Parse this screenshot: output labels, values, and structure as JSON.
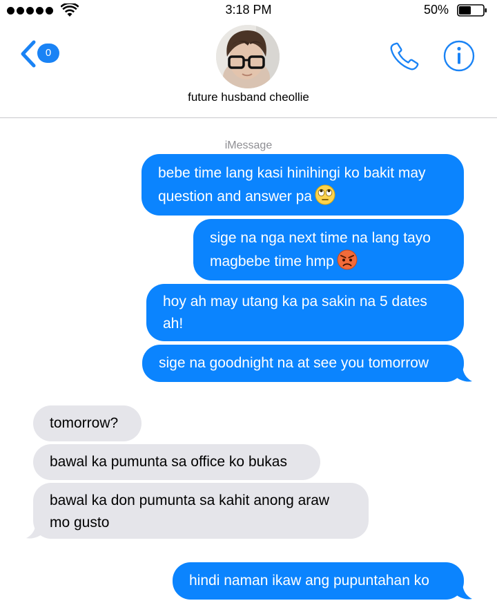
{
  "status_bar": {
    "time": "3:18 PM",
    "battery": "50%",
    "battery_level": 0.5
  },
  "header": {
    "back_badge_count": "0",
    "contact_name": "future husband cheollie"
  },
  "conversation": {
    "service_label": "iMessage",
    "messages": [
      {
        "direction": "sent",
        "lines": [
          "bebe time lang kasi hinihingi ko bakit may",
          "question and answer pa"
        ],
        "emoji": "face-with-rolling-eyes"
      },
      {
        "direction": "sent",
        "lines": [
          "sige na nga next time na lang tayo",
          "magbebe time hmp"
        ],
        "emoji": "angry-face"
      },
      {
        "direction": "sent",
        "lines": [
          "hoy ah may utang ka pa sakin na 5 dates",
          "ah!"
        ]
      },
      {
        "direction": "sent",
        "lines": [
          "sige na goodnight na at see you tomorrow"
        ]
      },
      {
        "direction": "received",
        "lines": [
          "tomorrow?"
        ]
      },
      {
        "direction": "received",
        "lines": [
          "bawal ka pumunta sa office ko bukas"
        ]
      },
      {
        "direction": "received",
        "lines": [
          "bawal ka don pumunta sa kahit anong araw",
          "mo gusto"
        ]
      },
      {
        "direction": "sent",
        "lines": [
          "hindi naman ikaw ang pupuntahan ko"
        ]
      }
    ]
  },
  "colors": {
    "accent": "#1a83f5",
    "sent_bubble": "#0b84fe",
    "received_bubble": "#e5e5ea",
    "meta_text": "#8e8e93"
  }
}
